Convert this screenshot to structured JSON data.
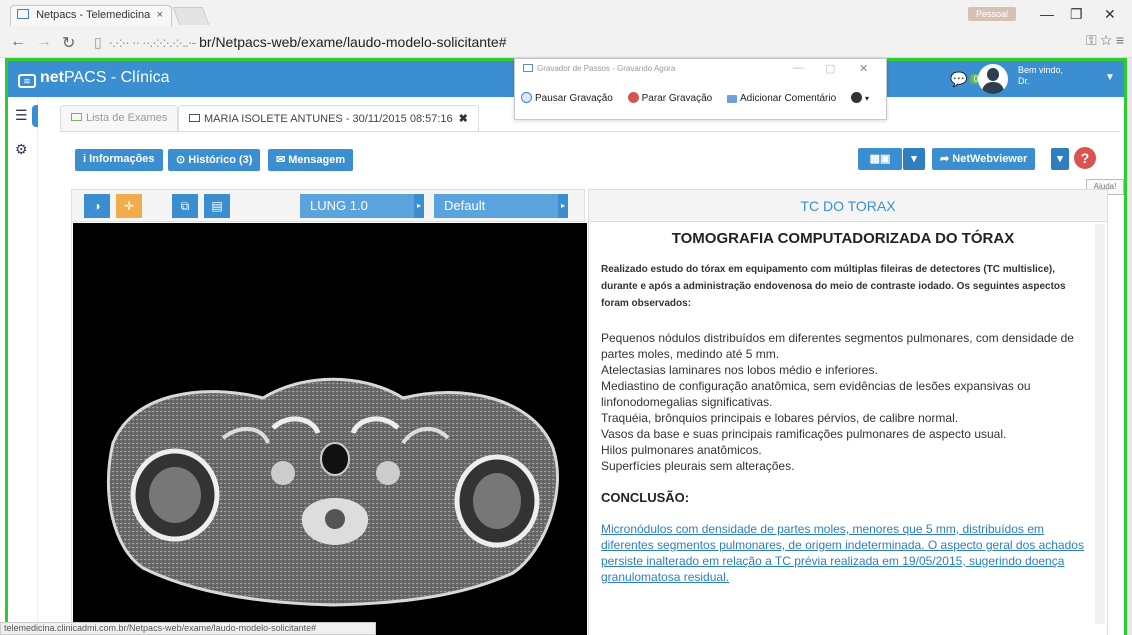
{
  "browser": {
    "tab_title": "Netpacs - Telemedicina",
    "tab_close": "×",
    "user_button": "Pessoal",
    "url_prefix": "br/Netpacs-web/exame/laudo-modelo-solicitante#",
    "status_url": "telemedicina.clinicadmi.com.br/Netpacs-web/exame/laudo-modelo-solicitante#"
  },
  "app": {
    "brand_bold": "net",
    "brand_rest": "PACS - Clínica",
    "chat_count": "0",
    "welcome_line1": "Bem vindo,",
    "welcome_line2": "Dr."
  },
  "tabs": [
    {
      "label": "Lista de Exames"
    },
    {
      "label": "MARIA ISOLETE ANTUNES - 30/11/2015 08:57:16"
    }
  ],
  "toolbar": {
    "info": "i Informações",
    "history": "⊙ Histórico (3)",
    "message": "✉ Mensagem",
    "netwebviewer": "➦ NetWebviewer",
    "help_tooltip": "Ajuda!"
  },
  "viewer": {
    "preset": "LUNG 1.0",
    "layout": "Default"
  },
  "report": {
    "header": "TC DO TORAX",
    "title": "TOMOGRAFIA COMPUTADORIZADA DO TÓRAX",
    "intro": "Realizado estudo do tórax em equipamento com múltiplas fileiras de detectores (TC multislice), durante e após a administração endovenosa do meio de contraste iodado. Os seguintes aspectos foram observados:",
    "findings": [
      "Pequenos nódulos distribuídos em diferentes segmentos pulmonares, com densidade de partes moles, medindo até 5 mm.",
      "Atelectasias laminares nos lobos médio e inferiores.",
      "Mediastino de configuração anatômica, sem evidências de lesões expansivas ou linfonodomegalias significativas.",
      "Traquéia, brônquios principais e lobares pérvios, de calibre normal.",
      "Vasos da base e suas principais ramificações pulmonares de aspecto usual.",
      "Hilos pulmonares anatômicos.",
      "Superfícies pleurais sem alterações."
    ],
    "conclusion_heading": "CONCLUSÃO:",
    "conclusion": "Micronódulos com densidade de partes moles, menores que 5 mm, distribuídos em diferentes segmentos pulmonares, de origem indeterminada. O aspecto geral dos achados persiste inalterado em relação a TC prévia realizada em 19/05/2015, sugerindo doença granulomatosa residual."
  },
  "recorder": {
    "title": "Gravador de Passos - Gravando Agora",
    "pause": "Pausar Gravação",
    "stop": "Parar Gravação",
    "comment": "Adicionar Comentário"
  },
  "colors": {
    "primary": "#3b8fd0",
    "frame_green": "#2ecc2e",
    "help_red": "#d9534f",
    "tool_orange": "#f0ad4e"
  }
}
